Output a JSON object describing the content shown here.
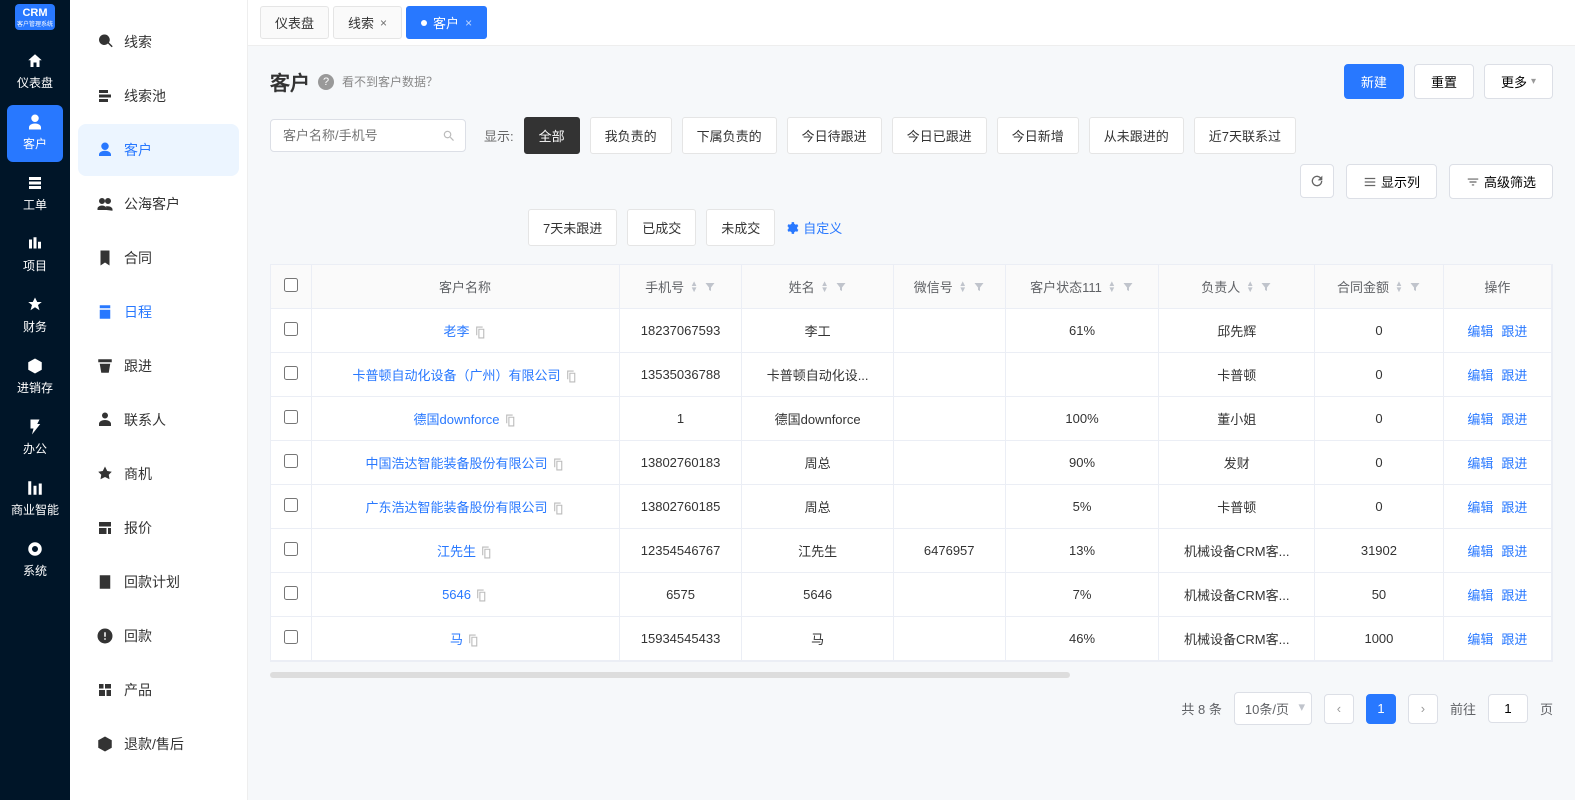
{
  "nav": {
    "logo_main": "CRM",
    "logo_sub": "客户管理系统",
    "items": [
      "仪表盘",
      "客户",
      "工单",
      "项目",
      "财务",
      "进销存",
      "办公",
      "商业智能",
      "系统"
    ],
    "active_index": 1
  },
  "sub_nav": {
    "items": [
      "线索",
      "线索池",
      "客户",
      "公海客户",
      "合同",
      "日程",
      "跟进",
      "联系人",
      "商机",
      "报价",
      "回款计划",
      "回款",
      "产品",
      "退款/售后"
    ],
    "active_index": 2,
    "schedule_index": 5
  },
  "tabs": [
    {
      "label": "仪表盘",
      "closable": false,
      "active": false
    },
    {
      "label": "线索",
      "closable": true,
      "active": false
    },
    {
      "label": "客户",
      "closable": true,
      "active": true,
      "dot": true
    }
  ],
  "page": {
    "title": "客户",
    "hint": "看不到客户数据？",
    "btn_new": "新建",
    "btn_reset": "重置",
    "btn_more": "更多"
  },
  "toolbar": {
    "search_placeholder": "客户名称/手机号",
    "show_label": "显示:",
    "filters_row1": [
      "全部",
      "我负责的",
      "下属负责的",
      "今日待跟进",
      "今日已跟进",
      "今日新增",
      "从未跟进的",
      "近7天联系过"
    ],
    "filters_row2": [
      "7天未跟进",
      "已成交",
      "未成交"
    ],
    "custom": "自定义",
    "btn_columns": "显示列",
    "btn_advanced": "高级筛选",
    "active_filter": "全部"
  },
  "table": {
    "columns": [
      "客户名称",
      "手机号",
      "姓名",
      "微信号",
      "客户状态111",
      "负责人",
      "合同金额",
      "操作"
    ],
    "action_edit": "编辑",
    "action_follow": "跟进",
    "rows": [
      {
        "name": "老李",
        "phone": "18237067593",
        "contact": "李工",
        "wechat": "",
        "status": "61%",
        "owner": "邱先辉",
        "amount": "0"
      },
      {
        "name": "卡普顿自动化设备（广州）有限公司",
        "phone": "13535036788",
        "contact": "卡普顿自动化设...",
        "wechat": "",
        "status": "",
        "owner": "卡普顿",
        "amount": "0"
      },
      {
        "name": "德国downforce",
        "phone": "1",
        "contact": "德国downforce",
        "wechat": "",
        "status": "100%",
        "owner": "董小姐",
        "amount": "0"
      },
      {
        "name": "中国浩达智能装备股份有限公司",
        "phone": "13802760183",
        "contact": "周总",
        "wechat": "",
        "status": "90%",
        "owner": "发财",
        "amount": "0"
      },
      {
        "name": "广东浩达智能装备股份有限公司",
        "phone": "13802760185",
        "contact": "周总",
        "wechat": "",
        "status": "5%",
        "owner": "卡普顿",
        "amount": "0"
      },
      {
        "name": "江先生",
        "phone": "12354546767",
        "contact": "江先生",
        "wechat": "6476957",
        "status": "13%",
        "owner": "机械设备CRM客...",
        "amount": "31902"
      },
      {
        "name": "5646",
        "phone": "6575",
        "contact": "5646",
        "wechat": "",
        "status": "7%",
        "owner": "机械设备CRM客...",
        "amount": "50"
      },
      {
        "name": "马",
        "phone": "15934545433",
        "contact": "马",
        "wechat": "",
        "status": "46%",
        "owner": "机械设备CRM客...",
        "amount": "1000"
      }
    ]
  },
  "pagination": {
    "total_label": "共 8 条",
    "per_page": "10条/页",
    "current": "1",
    "goto_label": "前往",
    "goto_value": "1",
    "page_suffix": "页"
  }
}
